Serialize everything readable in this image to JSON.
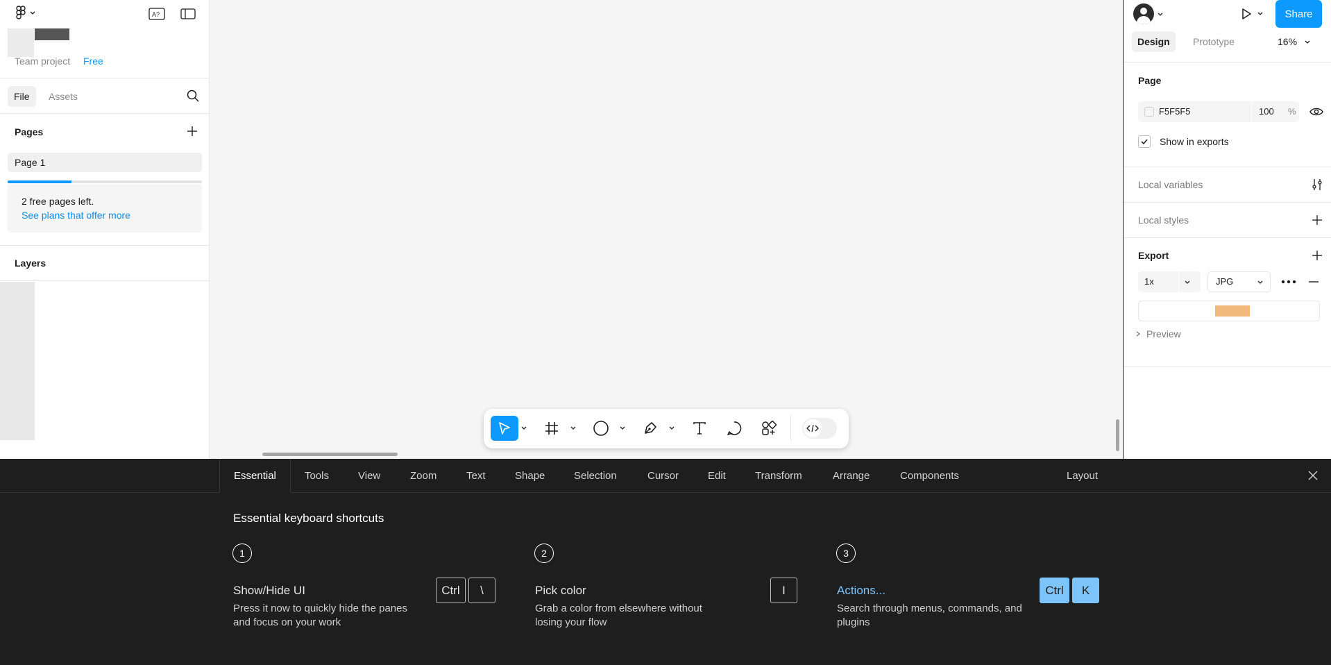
{
  "left_panel": {
    "team_project": "Team project",
    "plan_badge": "Free",
    "tabs": {
      "file": "File",
      "assets": "Assets"
    },
    "pages_title": "Pages",
    "page_items": [
      "Page 1"
    ],
    "page_quota_progress": 0.33,
    "upsell_text": "2 free pages left.",
    "upsell_link": "See plans that offer more",
    "layers_title": "Layers"
  },
  "toolbar": {
    "tools": [
      "move-tool",
      "frame-tool",
      "ellipse-tool",
      "pen-tool",
      "text-tool",
      "comment-tool",
      "actions-tool",
      "dev-mode-toggle"
    ]
  },
  "right_panel": {
    "share_label": "Share",
    "tabs": {
      "design": "Design",
      "prototype": "Prototype"
    },
    "zoom": "16%",
    "page_section": {
      "title": "Page",
      "fill_hex": "F5F5F5",
      "fill_opacity": "100",
      "opacity_unit": "%",
      "show_in_exports_label": "Show in exports",
      "show_in_exports_checked": true
    },
    "local_variables": "Local variables",
    "local_styles": "Local styles",
    "export": {
      "title": "Export",
      "scale": "1x",
      "format": "JPG",
      "preview_label": "Preview"
    }
  },
  "shortcuts_panel": {
    "tabs": [
      "Essential",
      "Tools",
      "View",
      "Zoom",
      "Text",
      "Shape",
      "Selection",
      "Cursor",
      "Edit",
      "Transform",
      "Arrange",
      "Components",
      "Layout"
    ],
    "active_tab": "Essential",
    "title": "Essential keyboard shortcuts",
    "items": [
      {
        "num": "1",
        "name": "Show/Hide UI",
        "desc": "Press it now to quickly hide the panes and focus on your work",
        "keys": [
          "Ctrl",
          "\\"
        ]
      },
      {
        "num": "2",
        "name": "Pick color",
        "desc": "Grab a color from elsewhere without losing your flow",
        "keys": [
          "I"
        ]
      },
      {
        "num": "3",
        "name": "Actions...",
        "desc": "Search through menus, commands, and plugins",
        "keys": [
          "Ctrl",
          "K"
        ]
      }
    ]
  },
  "colors": {
    "accent": "#0d99ff",
    "shortcut_bg": "#1e1e1e",
    "shortcut_accent": "#7cc4fa"
  }
}
